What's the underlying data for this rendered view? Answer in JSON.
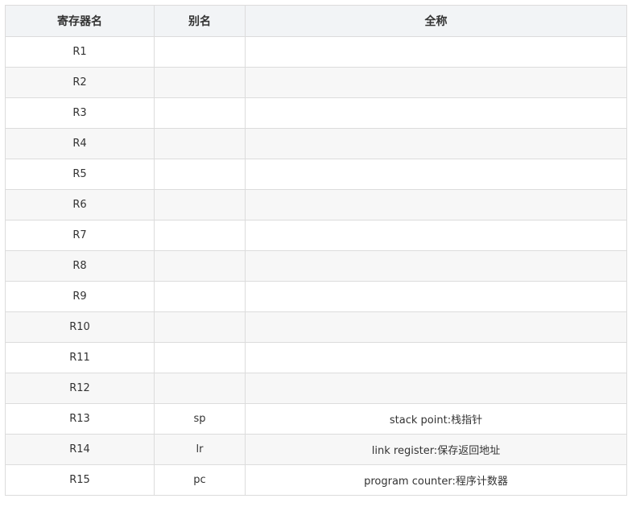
{
  "table": {
    "headers": [
      "寄存器名",
      "别名",
      "全称"
    ],
    "rows": [
      [
        "R1",
        "",
        ""
      ],
      [
        "R2",
        "",
        ""
      ],
      [
        "R3",
        "",
        ""
      ],
      [
        "R4",
        "",
        ""
      ],
      [
        "R5",
        "",
        ""
      ],
      [
        "R6",
        "",
        ""
      ],
      [
        "R7",
        "",
        ""
      ],
      [
        "R8",
        "",
        ""
      ],
      [
        "R9",
        "",
        ""
      ],
      [
        "R10",
        "",
        ""
      ],
      [
        "R11",
        "",
        ""
      ],
      [
        "R12",
        "",
        ""
      ],
      [
        "R13",
        "sp",
        "stack point:栈指针"
      ],
      [
        "R14",
        "lr",
        "link register:保存返回地址"
      ],
      [
        "R15",
        "pc",
        "program counter:程序计数器"
      ]
    ]
  }
}
